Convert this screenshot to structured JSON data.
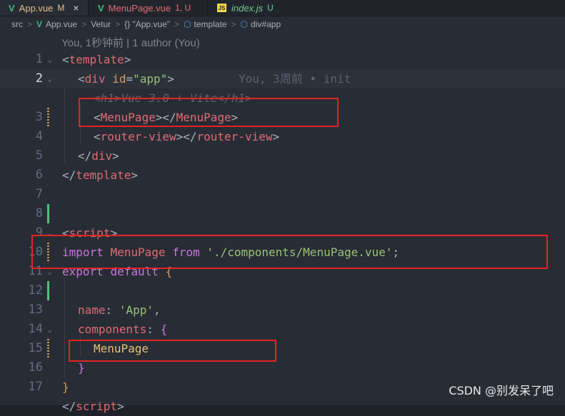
{
  "tabs": [
    {
      "icon": "V",
      "name": "App.vue",
      "status": "M"
    },
    {
      "icon": "V",
      "name": "MenuPage.vue",
      "status": "1, U"
    },
    {
      "icon": "JS",
      "name": "index.js",
      "status": "U"
    }
  ],
  "tab_close": "×",
  "breadcrumb": {
    "items": [
      "src",
      "App.vue",
      "Vetur",
      "{} \"App.vue\"",
      "template",
      "div#app"
    ],
    "separator": ">"
  },
  "codelens": "You, 1秒钟前 | 1 author (You)",
  "blame_line2": "You, 3周前 • init",
  "lines": {
    "l1": {
      "num": "1"
    },
    "l2": {
      "num": "2"
    },
    "l3": {
      "num": "3"
    },
    "l4": {
      "num": "4"
    },
    "l5": {
      "num": "5"
    },
    "l6": {
      "num": "6"
    },
    "l7": {
      "num": "7"
    },
    "l8": {
      "num": "8"
    },
    "l9": {
      "num": "9"
    },
    "l10": {
      "num": "10"
    },
    "l11": {
      "num": "11"
    },
    "l12": {
      "num": "12"
    },
    "l13": {
      "num": "13"
    },
    "l14": {
      "num": "14"
    },
    "l15": {
      "num": "15"
    },
    "l16": {
      "num": "16"
    },
    "l17": {
      "num": "17"
    }
  },
  "code": {
    "template_open_tag": "template",
    "div_tag": "div",
    "id_attr": "id",
    "id_value": "\"app\"",
    "commented_h1": "<h1>Vue 3.0 + Vite</h1>",
    "menupage_tag": "MenuPage",
    "router_view_tag": "router-view",
    "import_kw": "import",
    "import_name": "MenuPage",
    "from_kw": "from",
    "import_path": "'./components/MenuPage.vue'",
    "script_tag": "script",
    "export_kw": "export",
    "default_kw": "default",
    "name_prop": "name",
    "name_value": "'App'",
    "components_prop": "components",
    "components_item": "MenuPage"
  },
  "watermark": "CSDN @别发呆了吧",
  "colors": {
    "editor_bg": "#282c34",
    "tag": "#e06c75",
    "string": "#98c379",
    "keyword": "#c678dd",
    "highlight_box": "#e02525"
  }
}
